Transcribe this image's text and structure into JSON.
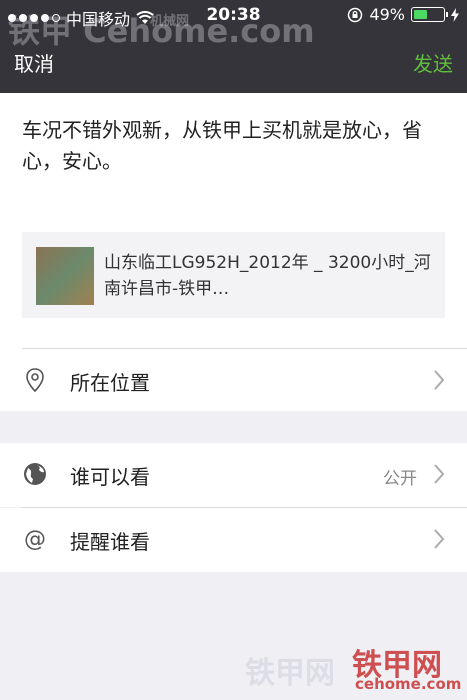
{
  "status_bar": {
    "carrier": "中国移动",
    "time": "20:38",
    "battery_percent": "49%",
    "battery_level": 0.49
  },
  "nav": {
    "cancel_label": "取消",
    "send_label": "发送"
  },
  "composer": {
    "text": "车况不错外观新，从铁甲上买机就是放心，省心，安心。",
    "link_card": {
      "title": "山东临工LG952H_2012年 _ 3200小时_河南许昌市-铁甲…"
    }
  },
  "rows": {
    "location": {
      "label": "所在位置",
      "icon": "location-pin-icon"
    },
    "visibility": {
      "label": "谁可以看",
      "value": "公开",
      "icon": "globe-icon"
    },
    "remind": {
      "label": "提醒谁看",
      "icon": "at-icon"
    }
  },
  "watermarks": {
    "top": "铁甲 Cehome.com",
    "top_small": "机械网",
    "bottom_left": "铁甲网",
    "bottom_right": "铁甲网",
    "bottom_url": "cehome.com"
  },
  "colors": {
    "nav_bg": "#34343a",
    "send": "#5fbf3d",
    "battery": "#4cd964"
  }
}
